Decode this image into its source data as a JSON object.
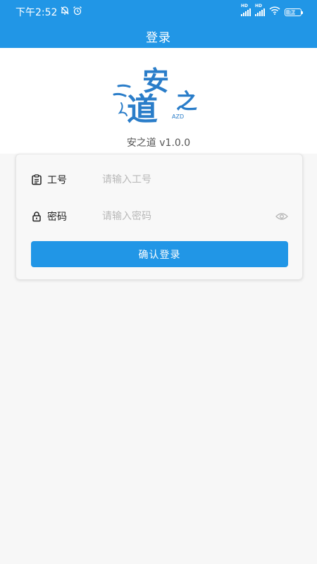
{
  "status_bar": {
    "time": "下午2:52",
    "signal_1_label": "HD",
    "signal_2_label": "HD",
    "battery_level": "57"
  },
  "header": {
    "title": "登录"
  },
  "logo": {
    "char_an": "安",
    "char_dao": "道",
    "char_zhi": "之",
    "abbr": "AZD"
  },
  "version": "安之道 v1.0.0",
  "form": {
    "account_label": "工号",
    "account_placeholder": "请输入工号",
    "account_value": "",
    "password_label": "密码",
    "password_placeholder": "请输入密码",
    "password_value": "",
    "submit_label": "确认登录"
  },
  "colors": {
    "primary": "#2196e6",
    "background": "#f7f7f7"
  },
  "icons": {
    "account": "id-card-icon",
    "password": "lock-icon",
    "visibility": "eye-icon",
    "notification_off": "bell-off-icon",
    "alarm": "alarm-clock-icon",
    "wifi": "wifi-icon"
  }
}
